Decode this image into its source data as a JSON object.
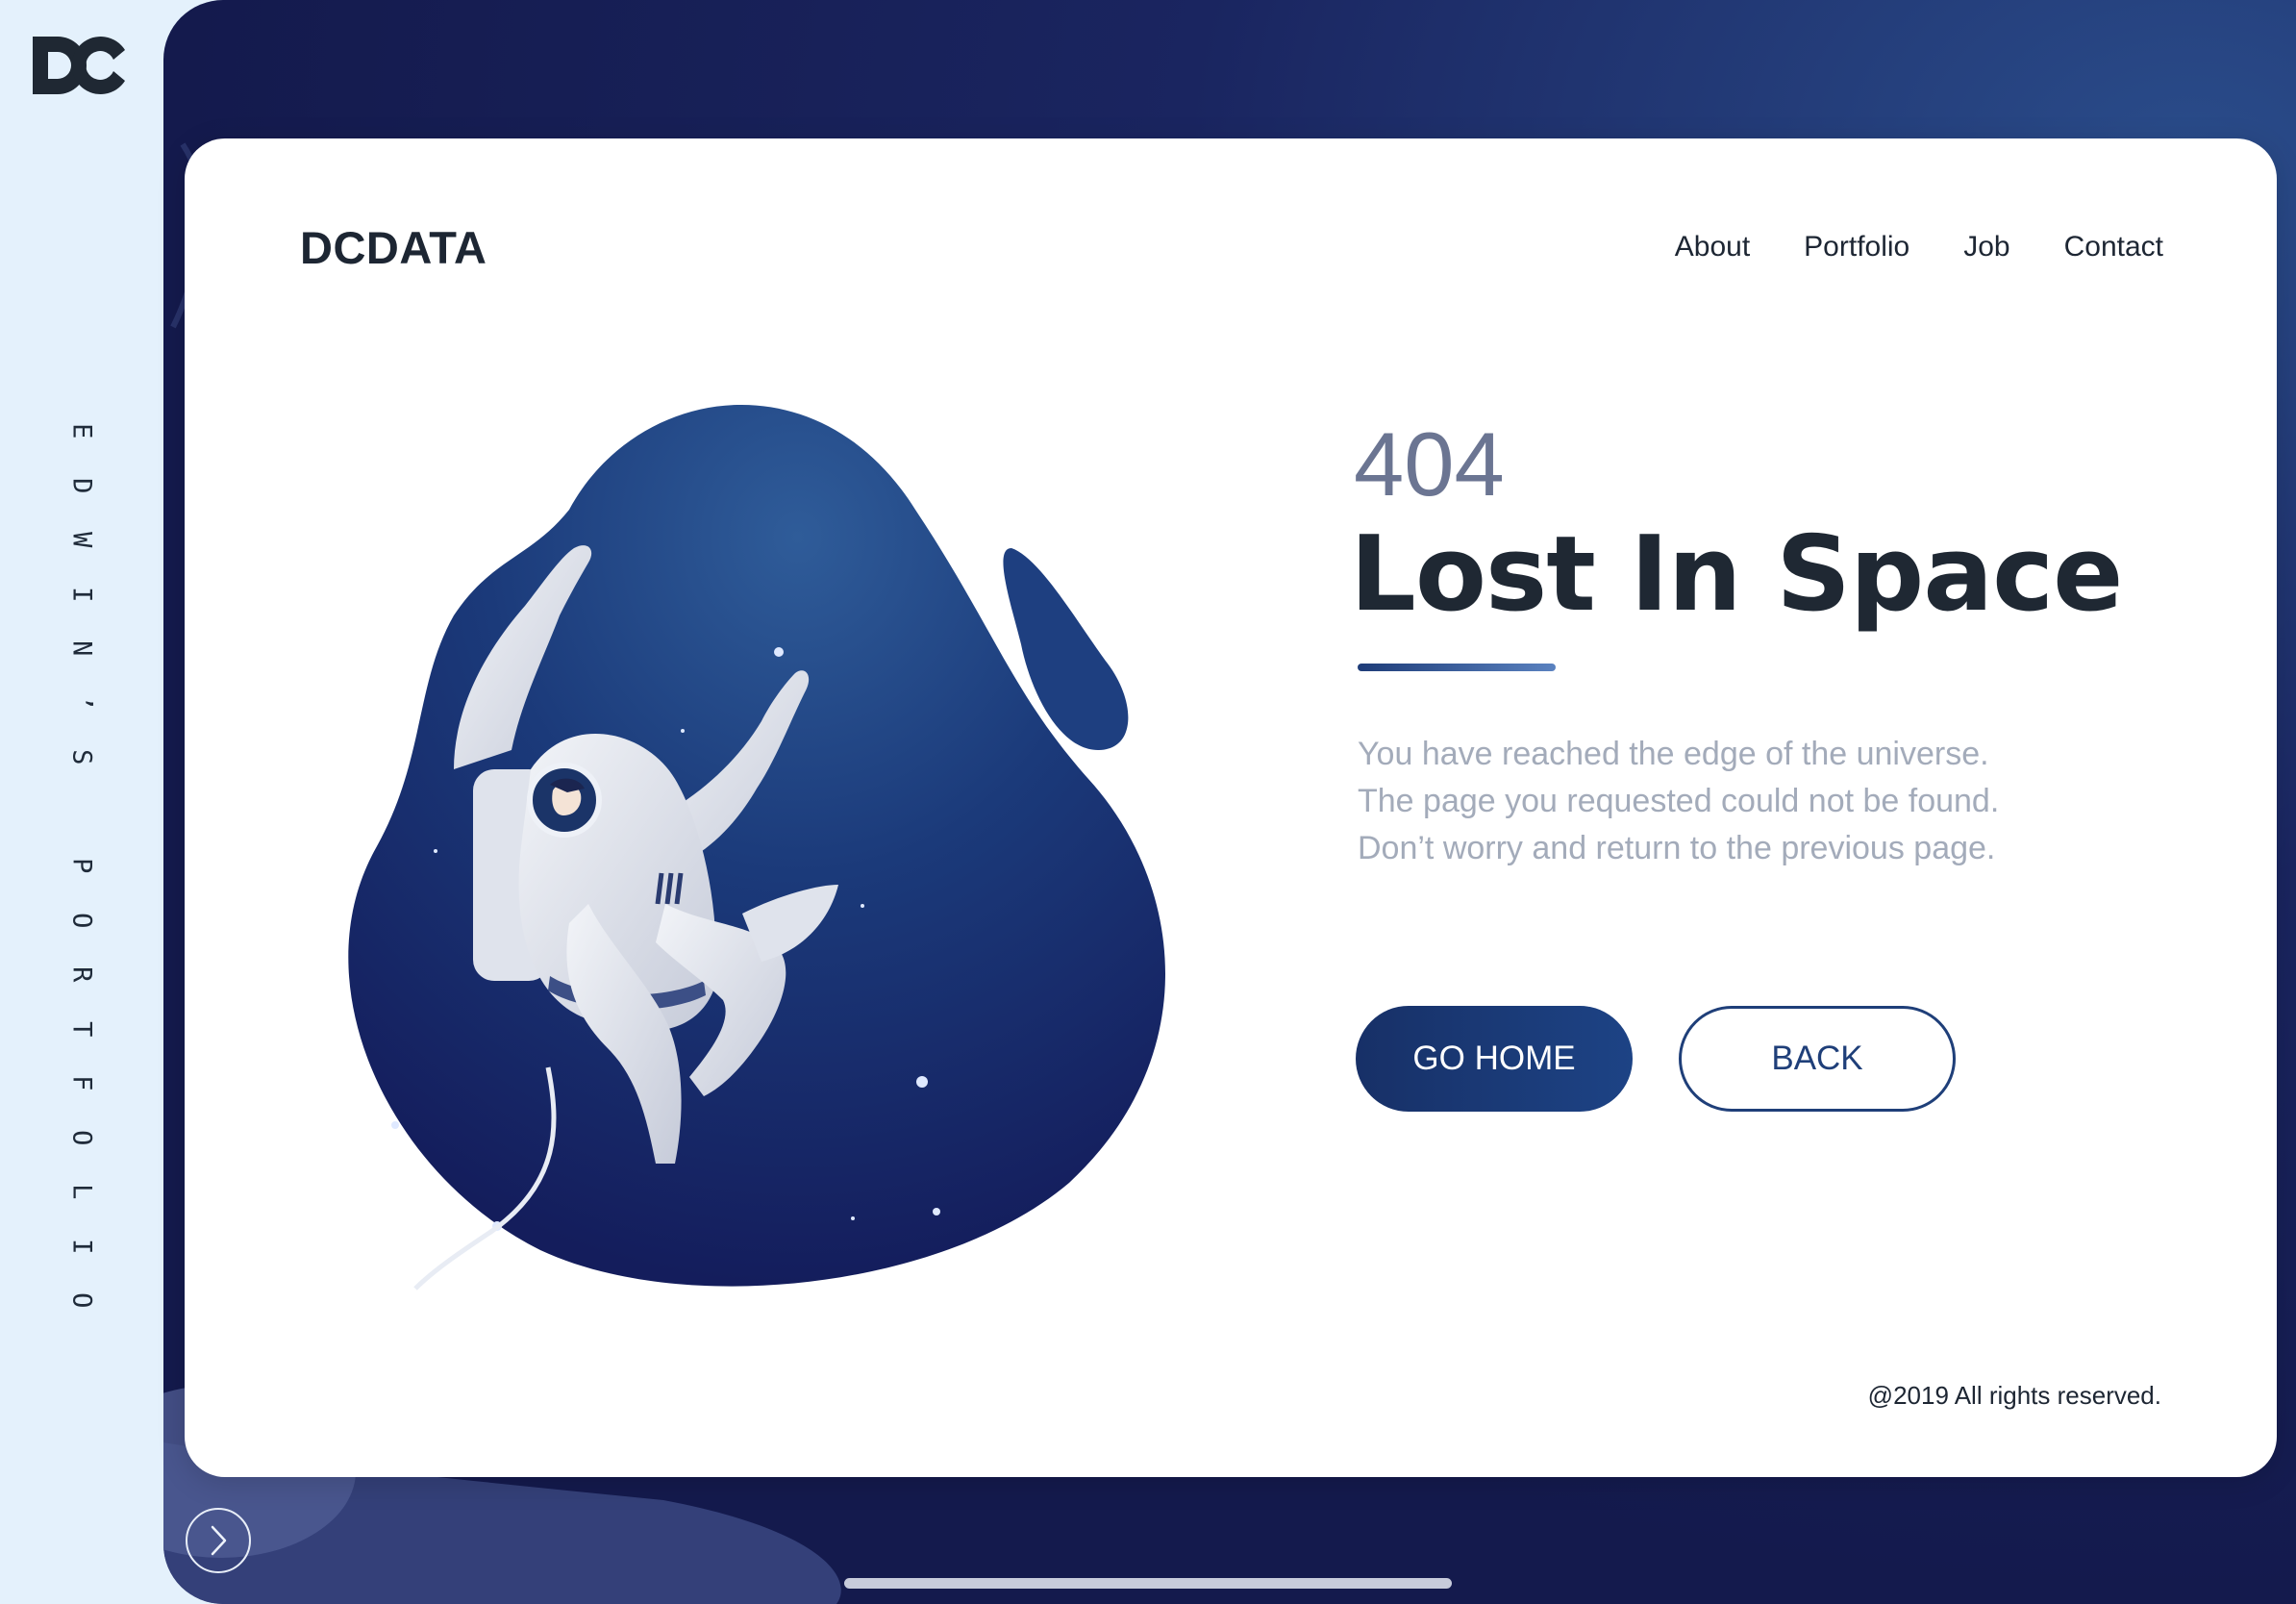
{
  "sidebar": {
    "logo_icon": "dc-logo-icon",
    "vertical_label": [
      "E",
      "D",
      "W",
      "I",
      "N",
      "’",
      "S",
      " ",
      "P",
      "O",
      "R",
      "T",
      "F",
      "O",
      "L",
      "I",
      "O"
    ]
  },
  "header": {
    "brand": "DCDATA",
    "nav": [
      "About",
      "Portfolio",
      "Job",
      "Contact"
    ]
  },
  "error": {
    "code": "404",
    "headline": "Lost In Space",
    "message": [
      "You have reached the edge of the universe.",
      "The page you requested could not be found.",
      "Don’t worry and return to the previous page."
    ]
  },
  "actions": {
    "home_label": "GO HOME",
    "back_label": "BACK"
  },
  "footer": {
    "copyright": "@2019 All rights reserved."
  },
  "controls": {
    "next_icon": "chevron-right-icon"
  },
  "colors": {
    "primary": "#1d4385",
    "dark_bg": "#141a4d",
    "text_dark": "#1d2633",
    "text_muted": "#a3abba",
    "sidebar_bg": "#e4f1fc"
  }
}
